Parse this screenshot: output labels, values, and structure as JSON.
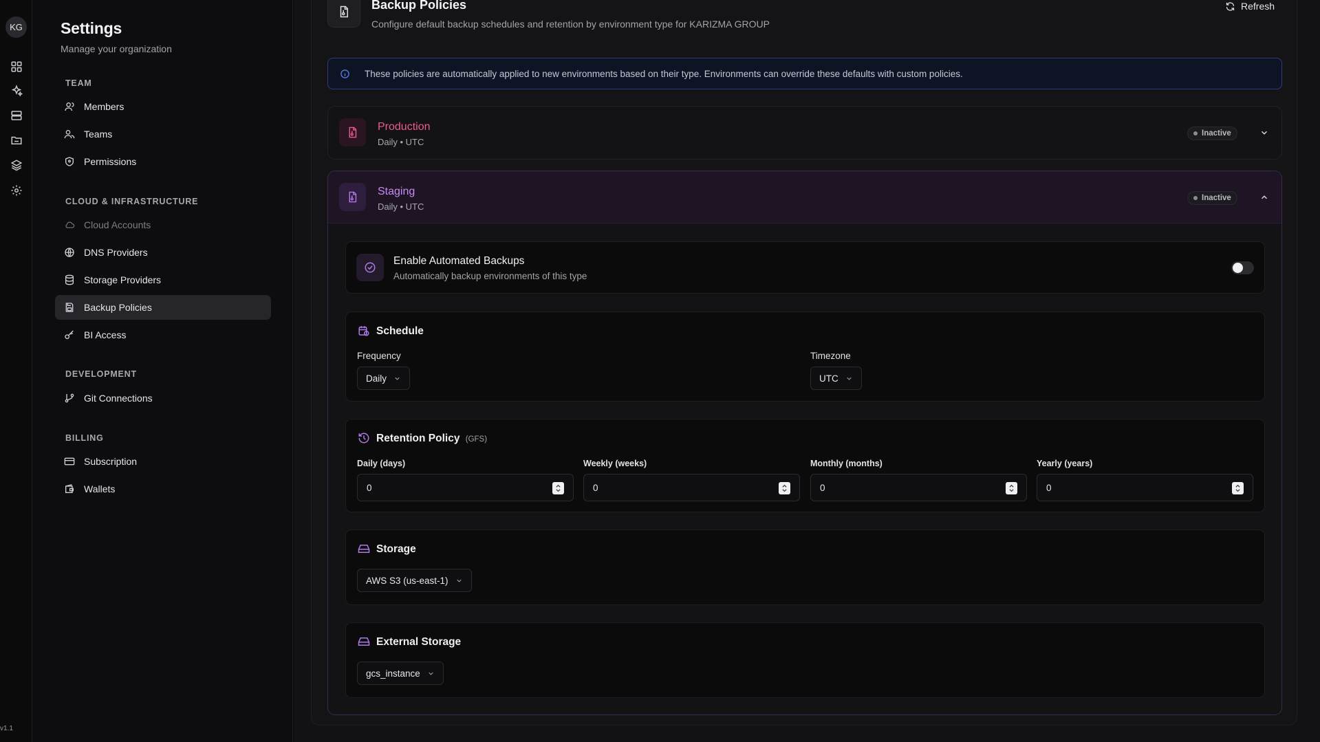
{
  "rail": {
    "avatar_initials": "KG",
    "icons": [
      "dashboard-icon",
      "sparkles-icon",
      "server-icon",
      "folder-icon",
      "layers-icon",
      "gear-icon"
    ],
    "version": "v1.1"
  },
  "sidebar": {
    "title": "Settings",
    "subtitle": "Manage your organization",
    "sections": {
      "team": "TEAM",
      "cloud": "CLOUD & INFRASTRUCTURE",
      "development": "DEVELOPMENT",
      "billing": "BILLING"
    },
    "items": {
      "members": "Members",
      "teams": "Teams",
      "permissions": "Permissions",
      "cloud_accounts": "Cloud Accounts",
      "dns_providers": "DNS Providers",
      "storage_providers": "Storage Providers",
      "backup_policies": "Backup Policies",
      "bi_access": "BI Access",
      "git_connections": "Git Connections",
      "subscription": "Subscription",
      "wallets": "Wallets"
    },
    "active_item": "Backup Policies"
  },
  "header": {
    "title": "Backup Policies",
    "subtitle": "Configure default backup schedules and retention by environment type for KARIZMA GROUP",
    "refresh_label": "Refresh"
  },
  "info_banner": {
    "text": "These policies are automatically applied to new environments based on their type. Environments can override these defaults with custom policies."
  },
  "environments": {
    "production": {
      "name": "Production",
      "meta": "Daily • UTC",
      "status": "Inactive",
      "color": "#ec5a97",
      "expanded": false
    },
    "staging": {
      "name": "Staging",
      "meta": "Daily • UTC",
      "status": "Inactive",
      "color": "#b07ae6",
      "expanded": true
    }
  },
  "staging_config": {
    "automated": {
      "title": "Enable Automated Backups",
      "subtitle": "Automatically backup environments of this type",
      "enabled": false
    },
    "schedule": {
      "title": "Schedule",
      "frequency_label": "Frequency",
      "frequency_value": "Daily",
      "timezone_label": "Timezone",
      "timezone_value": "UTC"
    },
    "retention": {
      "title": "Retention Policy",
      "tag": "(GFS)",
      "daily_label": "Daily (days)",
      "daily_value": "0",
      "weekly_label": "Weekly (weeks)",
      "weekly_value": "0",
      "monthly_label": "Monthly (months)",
      "monthly_value": "0",
      "yearly_label": "Yearly (years)",
      "yearly_value": "0"
    },
    "storage": {
      "title": "Storage",
      "value": "AWS S3 (us-east-1)"
    },
    "external_storage": {
      "title": "External Storage",
      "value": "gcs_instance"
    }
  },
  "colors": {
    "accent_purple": "#b07ae6",
    "accent_pink": "#ec5a97",
    "info_blue": "#5a82f0"
  }
}
